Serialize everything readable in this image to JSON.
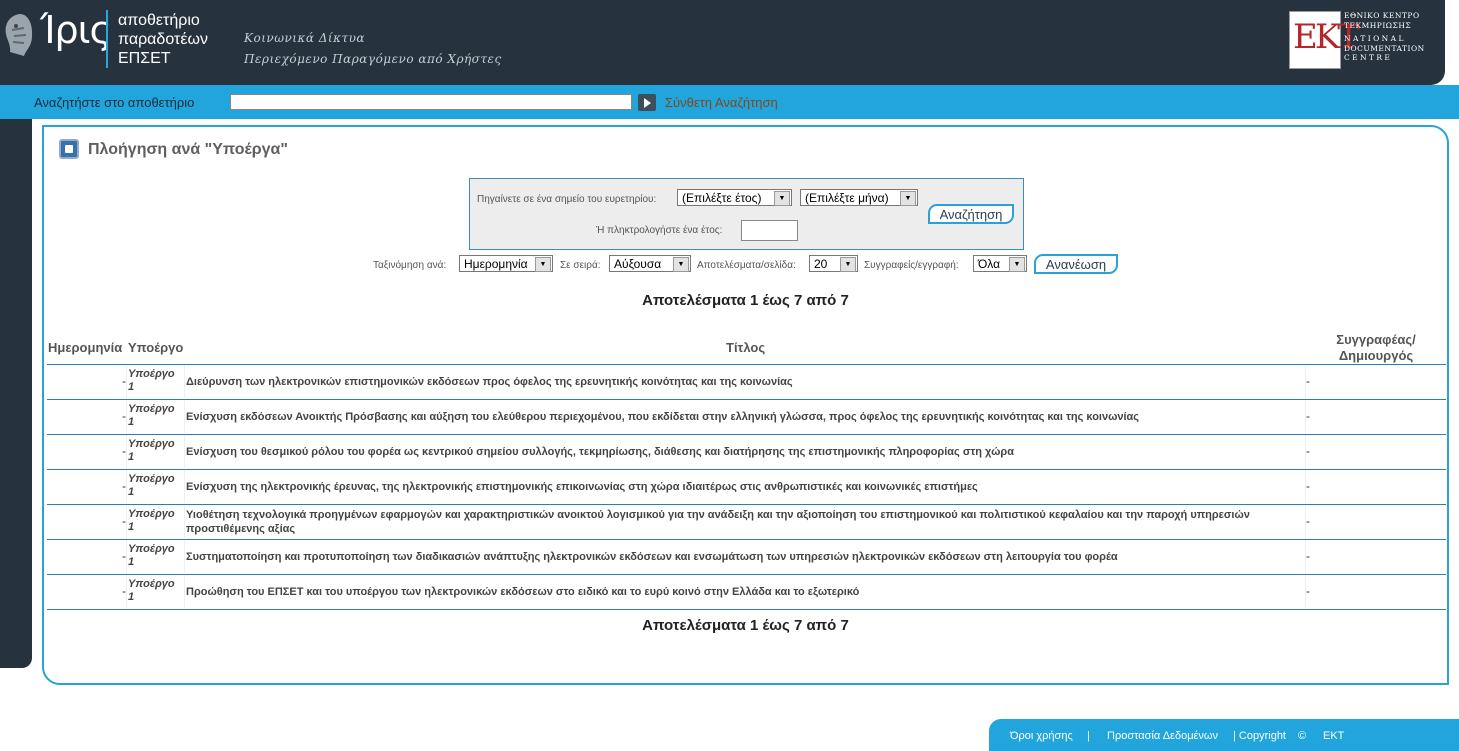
{
  "header": {
    "logo_word": "Ίρις",
    "logo_lines": [
      "αποθετήριο",
      "παραδοτέων",
      "ΕΠΣΕΤ"
    ],
    "tagline_lines": [
      "Κοινωνικά Δίκτυα",
      "Περιεχόμενο Παραγόμενο από Χρήστες"
    ],
    "ekt_logo": "EKT",
    "ekt_lines": [
      "ΕΘΝΙΚΟ ΚΕΝΤΡΟ",
      "ΤΕΚΜΗΡΙΩΣΗΣ",
      "NATIONAL",
      "DOCUMENTATION",
      "CENTRE"
    ]
  },
  "search": {
    "label": "Αναζητήστε στο αποθετήριο",
    "value": "",
    "advanced_label": "Σύνθετη Αναζήτηση"
  },
  "page": {
    "title": "Πλοήγηση ανά \"Υποέργα\""
  },
  "jump": {
    "goto_label": "Πηγαίνετε σε ένα σημείο του ευρετηρίου:",
    "year_select": "(Επιλέξτε έτος)",
    "month_select": "(Επιλέξτε μήνα)",
    "type_year_label": "Ή πληκτρολογήστε ένα έτος:",
    "search_button": "Αναζήτηση"
  },
  "sort": {
    "sort_by_label": "Ταξινόμηση ανά:",
    "sort_by_value": "Ημερομηνία",
    "order_label": "Σε σειρά:",
    "order_value": "Αύξουσα",
    "per_page_label": "Αποτελέσματα/σελίδα:",
    "per_page_value": "20",
    "authors_label": "Συγγραφείς/εγγραφή:",
    "authors_value": "Όλα",
    "refresh_button": "Ανανέωση"
  },
  "results_text": "Αποτελέσματα 1 έως 7 από 7",
  "table": {
    "headers": {
      "date": "Ημερομηνία",
      "subproject": "Υποέργο",
      "title": "Τίτλος",
      "author_1": "Συγγραφέας/",
      "author_2": "Δημιουργός"
    },
    "rows": [
      {
        "date": "-",
        "sub1": "Υποέργο",
        "sub2": "1",
        "title": "Διεύρυνση των ηλεκτρονικών επιστημονικών εκδόσεων προς όφελος της ερευνητικής κοινότητας και της κοινωνίας",
        "author": "-"
      },
      {
        "date": "-",
        "sub1": "Υποέργο",
        "sub2": "1",
        "title": "Ενίσχυση εκδόσεων Ανοικτής Πρόσβασης και αύξηση του ελεύθερου περιεχομένου, που εκδίδεται στην ελληνική γλώσσα, προς όφελος της ερευνητικής κοινότητας και της κοινωνίας",
        "author": "-"
      },
      {
        "date": "-",
        "sub1": "Υποέργο",
        "sub2": "1",
        "title": "Ενίσχυση του θεσμικού ρόλου του φορέα ως κεντρικού σημείου συλλογής, τεκμηρίωσης, διάθεσης και διατήρησης της επιστημονικής πληροφορίας στη χώρα",
        "author": "-"
      },
      {
        "date": "-",
        "sub1": "Υποέργο",
        "sub2": "1",
        "title": "Ενίσχυση της ηλεκτρονικής έρευνας, της ηλεκτρονικής επιστημονικής επικοινωνίας στη χώρα ιδιαιτέρως στις ανθρωπιστικές και κοινωνικές επιστήμες",
        "author": "-"
      },
      {
        "date": "-",
        "sub1": "Υποέργο",
        "sub2": "1",
        "title": "Υιοθέτηση τεχνολογικά προηγμένων εφαρμογών και χαρακτηριστικών ανοικτού λογισμικού για την ανάδειξη και την αξιοποίηση του επιστημονικού και πολιτιστικού κεφαλαίου και την παροχή υπηρεσιών προστιθέμενης αξίας",
        "author": "-"
      },
      {
        "date": "-",
        "sub1": "Υποέργο",
        "sub2": "1",
        "title": "Συστηματοποίηση και προτυποποίηση των διαδικασιών ανάπτυξης ηλεκτρονικών εκδόσεων και ενσωμάτωση των υπηρεσιών ηλεκτρονικών εκδόσεων στη λειτουργία του φορέα",
        "author": "-"
      },
      {
        "date": "-",
        "sub1": "Υποέργο",
        "sub2": "1",
        "title": "Προώθηση του ΕΠΣΕΤ και του υποέργου των ηλεκτρονικών εκδόσεων στο ειδικό και το ευρύ κοινό στην Ελλάδα και το εξωτερικό",
        "author": "-"
      }
    ]
  },
  "footer": {
    "terms": "Όροι χρήσης",
    "sep1": "|",
    "privacy": "Προστασία Δεδομένων",
    "copyright": "| Copyright",
    "copyright_icon": "copyright-icon",
    "ekt": "ΕΚΤ"
  }
}
